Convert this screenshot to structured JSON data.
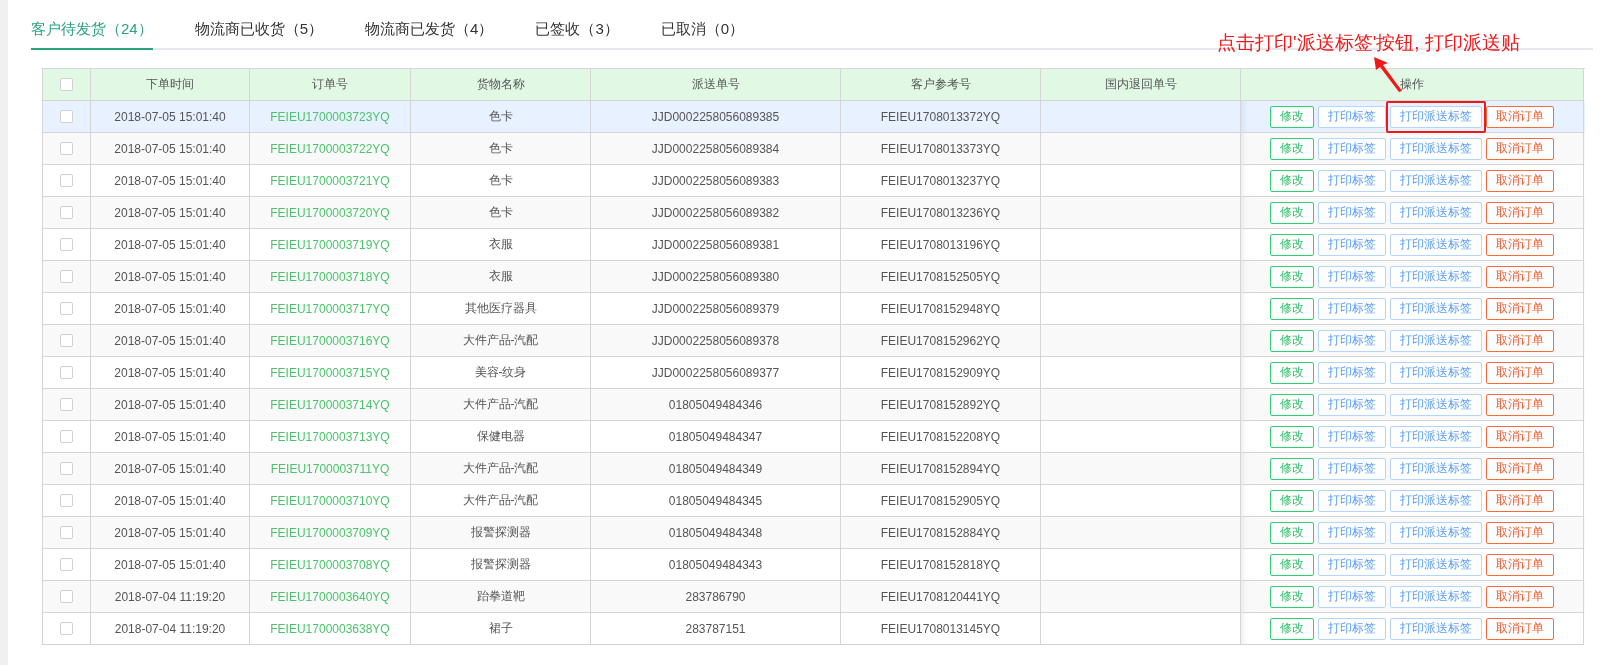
{
  "tabs": [
    {
      "label": "客户待发货（24）",
      "selected": true
    },
    {
      "label": "物流商已收货（5）",
      "selected": false
    },
    {
      "label": "物流商已发货（4）",
      "selected": false
    },
    {
      "label": "已签收（3）",
      "selected": false
    },
    {
      "label": "已取消（0）",
      "selected": false
    }
  ],
  "annotation": {
    "text": "点击打印'派送标签'按钮, 打印派送贴"
  },
  "table": {
    "all_checked": false,
    "columns": [
      "下单时间",
      "订单号",
      "货物名称",
      "派送单号",
      "客户参考号",
      "国内退回单号",
      "操作"
    ],
    "rows": [
      {
        "checked": false,
        "hovered": true,
        "highlighted": true,
        "time": "2018-07-05 15:01:40",
        "order": "FEIEU1700003723YQ",
        "goods": "色卡",
        "delivery": "JJD0002258056089385",
        "ref": "FEIEU1708013372YQ",
        "actions": [
          {
            "kind": "edit",
            "label": "修改"
          },
          {
            "kind": "print",
            "label": "打印标签"
          },
          {
            "kind": "delivery",
            "label": "打印派送标签"
          },
          {
            "kind": "cancel",
            "label": "取消订单"
          }
        ]
      },
      {
        "checked": false,
        "hovered": false,
        "highlighted": false,
        "time": "2018-07-05 15:01:40",
        "order": "FEIEU1700003722YQ",
        "goods": "色卡",
        "delivery": "JJD0002258056089384",
        "ref": "FEIEU1708013373YQ",
        "actions": [
          {
            "kind": "edit",
            "label": "修改"
          },
          {
            "kind": "print",
            "label": "打印标签"
          },
          {
            "kind": "delivery",
            "label": "打印派送标签"
          },
          {
            "kind": "cancel",
            "label": "取消订单"
          }
        ]
      },
      {
        "checked": false,
        "hovered": false,
        "highlighted": false,
        "time": "2018-07-05 15:01:40",
        "order": "FEIEU1700003721YQ",
        "goods": "色卡",
        "delivery": "JJD0002258056089383",
        "ref": "FEIEU1708013237YQ",
        "actions": [
          {
            "kind": "edit",
            "label": "修改"
          },
          {
            "kind": "print",
            "label": "打印标签"
          },
          {
            "kind": "delivery",
            "label": "打印派送标签"
          },
          {
            "kind": "cancel",
            "label": "取消订单"
          }
        ]
      },
      {
        "checked": false,
        "hovered": false,
        "highlighted": false,
        "time": "2018-07-05 15:01:40",
        "order": "FEIEU1700003720YQ",
        "goods": "色卡",
        "delivery": "JJD0002258056089382",
        "ref": "FEIEU1708013236YQ",
        "actions": [
          {
            "kind": "edit",
            "label": "修改"
          },
          {
            "kind": "print",
            "label": "打印标签"
          },
          {
            "kind": "delivery",
            "label": "打印派送标签"
          },
          {
            "kind": "cancel",
            "label": "取消订单"
          }
        ]
      },
      {
        "checked": false,
        "hovered": false,
        "highlighted": false,
        "time": "2018-07-05 15:01:40",
        "order": "FEIEU1700003719YQ",
        "goods": "衣服",
        "delivery": "JJD0002258056089381",
        "ref": "FEIEU1708013196YQ",
        "actions": [
          {
            "kind": "edit",
            "label": "修改"
          },
          {
            "kind": "print",
            "label": "打印标签"
          },
          {
            "kind": "delivery",
            "label": "打印派送标签"
          },
          {
            "kind": "cancel",
            "label": "取消订单"
          }
        ]
      },
      {
        "checked": false,
        "hovered": false,
        "highlighted": false,
        "time": "2018-07-05 15:01:40",
        "order": "FEIEU1700003718YQ",
        "goods": "衣服",
        "delivery": "JJD0002258056089380",
        "ref": "FEIEU1708152505YQ",
        "actions": [
          {
            "kind": "edit",
            "label": "修改"
          },
          {
            "kind": "print",
            "label": "打印标签"
          },
          {
            "kind": "delivery",
            "label": "打印派送标签"
          },
          {
            "kind": "cancel",
            "label": "取消订单"
          }
        ]
      },
      {
        "checked": false,
        "hovered": false,
        "highlighted": false,
        "time": "2018-07-05 15:01:40",
        "order": "FEIEU1700003717YQ",
        "goods": "其他医疗器具",
        "delivery": "JJD0002258056089379",
        "ref": "FEIEU1708152948YQ",
        "actions": [
          {
            "kind": "edit",
            "label": "修改"
          },
          {
            "kind": "print",
            "label": "打印标签"
          },
          {
            "kind": "delivery",
            "label": "打印派送标签"
          },
          {
            "kind": "cancel",
            "label": "取消订单"
          }
        ]
      },
      {
        "checked": false,
        "hovered": false,
        "highlighted": false,
        "time": "2018-07-05 15:01:40",
        "order": "FEIEU1700003716YQ",
        "goods": "大件产品-汽配",
        "delivery": "JJD0002258056089378",
        "ref": "FEIEU1708152962YQ",
        "actions": [
          {
            "kind": "edit",
            "label": "修改"
          },
          {
            "kind": "print",
            "label": "打印标签"
          },
          {
            "kind": "delivery",
            "label": "打印派送标签"
          },
          {
            "kind": "cancel",
            "label": "取消订单"
          }
        ]
      },
      {
        "checked": false,
        "hovered": false,
        "highlighted": false,
        "time": "2018-07-05 15:01:40",
        "order": "FEIEU1700003715YQ",
        "goods": "美容-纹身",
        "delivery": "JJD0002258056089377",
        "ref": "FEIEU1708152909YQ",
        "actions": [
          {
            "kind": "edit",
            "label": "修改"
          },
          {
            "kind": "print",
            "label": "打印标签"
          },
          {
            "kind": "delivery",
            "label": "打印派送标签"
          },
          {
            "kind": "cancel",
            "label": "取消订单"
          }
        ]
      },
      {
        "checked": false,
        "hovered": false,
        "highlighted": false,
        "time": "2018-07-05 15:01:40",
        "order": "FEIEU1700003714YQ",
        "goods": "大件产品-汽配",
        "delivery": "01805049484346",
        "ref": "FEIEU1708152892YQ",
        "actions": [
          {
            "kind": "edit",
            "label": "修改"
          },
          {
            "kind": "print",
            "label": "打印标签"
          },
          {
            "kind": "delivery",
            "label": "打印派送标签"
          },
          {
            "kind": "cancel",
            "label": "取消订单"
          }
        ]
      },
      {
        "checked": false,
        "hovered": false,
        "highlighted": false,
        "time": "2018-07-05 15:01:40",
        "order": "FEIEU1700003713YQ",
        "goods": "保健电器",
        "delivery": "01805049484347",
        "ref": "FEIEU1708152208YQ",
        "actions": [
          {
            "kind": "edit",
            "label": "修改"
          },
          {
            "kind": "print",
            "label": "打印标签"
          },
          {
            "kind": "delivery",
            "label": "打印派送标签"
          },
          {
            "kind": "cancel",
            "label": "取消订单"
          }
        ]
      },
      {
        "checked": false,
        "hovered": false,
        "highlighted": false,
        "time": "2018-07-05 15:01:40",
        "order": "FEIEU1700003711YQ",
        "goods": "大件产品-汽配",
        "delivery": "01805049484349",
        "ref": "FEIEU1708152894YQ",
        "actions": [
          {
            "kind": "edit",
            "label": "修改"
          },
          {
            "kind": "print",
            "label": "打印标签"
          },
          {
            "kind": "delivery",
            "label": "打印派送标签"
          },
          {
            "kind": "cancel",
            "label": "取消订单"
          }
        ]
      },
      {
        "checked": false,
        "hovered": false,
        "highlighted": false,
        "time": "2018-07-05 15:01:40",
        "order": "FEIEU1700003710YQ",
        "goods": "大件产品-汽配",
        "delivery": "01805049484345",
        "ref": "FEIEU1708152905YQ",
        "actions": [
          {
            "kind": "edit",
            "label": "修改"
          },
          {
            "kind": "print",
            "label": "打印标签"
          },
          {
            "kind": "delivery",
            "label": "打印派送标签"
          },
          {
            "kind": "cancel",
            "label": "取消订单"
          }
        ]
      },
      {
        "checked": false,
        "hovered": false,
        "highlighted": false,
        "time": "2018-07-05 15:01:40",
        "order": "FEIEU1700003709YQ",
        "goods": "报警探测器",
        "delivery": "01805049484348",
        "ref": "FEIEU1708152884YQ",
        "actions": [
          {
            "kind": "edit",
            "label": "修改"
          },
          {
            "kind": "print",
            "label": "打印标签"
          },
          {
            "kind": "delivery",
            "label": "打印派送标签"
          },
          {
            "kind": "cancel",
            "label": "取消订单"
          }
        ]
      },
      {
        "checked": false,
        "hovered": false,
        "highlighted": false,
        "time": "2018-07-05 15:01:40",
        "order": "FEIEU1700003708YQ",
        "goods": "报警探测器",
        "delivery": "01805049484343",
        "ref": "FEIEU1708152818YQ",
        "actions": [
          {
            "kind": "edit",
            "label": "修改"
          },
          {
            "kind": "print",
            "label": "打印标签"
          },
          {
            "kind": "delivery",
            "label": "打印派送标签"
          },
          {
            "kind": "cancel",
            "label": "取消订单"
          }
        ]
      },
      {
        "checked": false,
        "hovered": false,
        "highlighted": false,
        "time": "2018-07-04 11:19:20",
        "order": "FEIEU1700003640YQ",
        "goods": "跆拳道靶",
        "delivery": "283786790",
        "ref": "FEIEU1708120441YQ",
        "actions": [
          {
            "kind": "edit",
            "label": "修改"
          },
          {
            "kind": "print",
            "label": "打印标签"
          },
          {
            "kind": "delivery",
            "label": "打印派送标签"
          },
          {
            "kind": "cancel",
            "label": "取消订单"
          }
        ]
      },
      {
        "checked": false,
        "hovered": false,
        "highlighted": false,
        "time": "2018-07-04 11:19:20",
        "order": "FEIEU1700003638YQ",
        "goods": "裙子",
        "delivery": "283787151",
        "ref": "FEIEU1708013145YQ",
        "actions": [
          {
            "kind": "edit",
            "label": "修改"
          },
          {
            "kind": "print",
            "label": "打印标签"
          },
          {
            "kind": "delivery",
            "label": "打印派送标签"
          },
          {
            "kind": "cancel",
            "label": "取消订单"
          }
        ]
      }
    ]
  }
}
